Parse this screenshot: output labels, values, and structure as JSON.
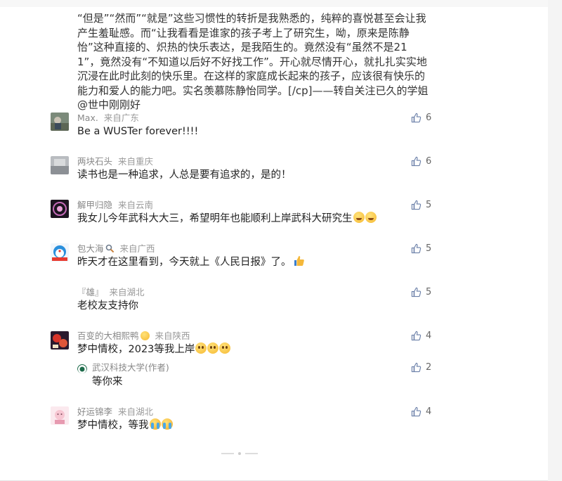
{
  "article": {
    "text": "“但是”“然而”“就是”这些习惯性的转折是我熟悉的，纯粹的喜悦甚至会让我产生羞耻感。而“让我看看是谁家的孩子考上了研究生，呦，原来是陈静怡”这种直接的、炽热的快乐表达，是我陌生的。竟然没有“虽然不是211”，竟然没有“不知道以后好不好找工作”。开心就尽情开心，就扎扎实实地沉浸在此时此刻的快乐里。在这样的家庭成长起来的孩子，应该很有快乐的能力和爱人的能力吧。实名羡慕陈静怡同学。[/cp]——转自关注已久的学姐@世中刚刚好"
  },
  "comments": [
    {
      "name": "Max.",
      "location": "来自广东",
      "text": "Be a WUSTer forever!!!!",
      "likes": "6",
      "avatar": "avatar-photo"
    },
    {
      "name": "两块石头",
      "location": "来自重庆",
      "text": "读书也是一种追求，人总是要有追求的，是的！",
      "likes": "6",
      "avatar": "avatar-grey"
    },
    {
      "name": "解甲归隐",
      "location": "来自云南",
      "text": "我女儿今年武科大大三，希望明年也能顺利上岸武科大研究生",
      "likes": "5",
      "avatar": "avatar-dark"
    },
    {
      "name": "包大海",
      "location": "来自广西",
      "text": "昨天才在这里看到，今天就上《人民日报》了。",
      "likes": "5",
      "avatar": "avatar-doraemon"
    },
    {
      "name": "『雄』",
      "location": "来自湖北",
      "text": "老校友支持你",
      "likes": "5",
      "avatar": "avatar-none"
    },
    {
      "name": "百变的大相熙鸭",
      "location": "来自陕西",
      "text": "梦中情校，2023等我上岸",
      "likes": "4",
      "avatar": "avatar-red"
    },
    {
      "name": "好运锦李",
      "location": "来自湖北",
      "text": "梦中情校，等我",
      "likes": "4",
      "avatar": "avatar-pink"
    }
  ],
  "reply": {
    "name": "武汉科技大学",
    "author_tag": "(作者)",
    "text": "等你来",
    "likes": "2"
  },
  "colors": {
    "like_icon": "#6a7fa8",
    "meta_text": "#888888",
    "body_text": "#222222"
  }
}
